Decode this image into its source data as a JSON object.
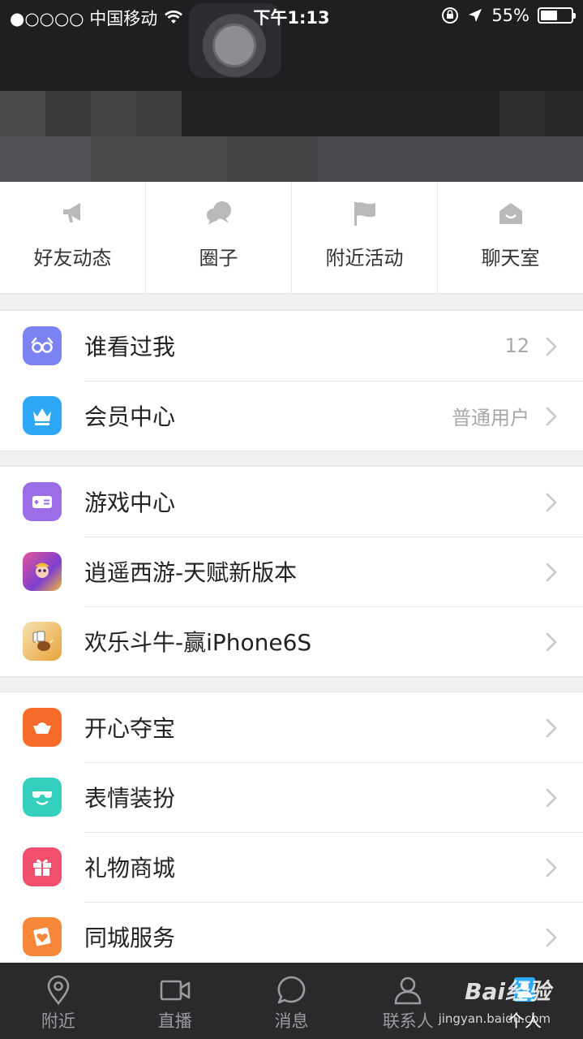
{
  "status_bar": {
    "carrier": "●○○○○ 中国移动",
    "time": "下午1:13",
    "battery": "55%",
    "battery_level": 0.55
  },
  "quick_actions": [
    {
      "label": "好友动态",
      "icon": "megaphone-icon"
    },
    {
      "label": "圈子",
      "icon": "chat-bubbles-icon"
    },
    {
      "label": "附近活动",
      "icon": "flag-icon"
    },
    {
      "label": "聊天室",
      "icon": "house-icon"
    }
  ],
  "group1": [
    {
      "label": "谁看过我",
      "value": "12",
      "icon": "glasses-icon",
      "color": "#7b83f2"
    },
    {
      "label": "会员中心",
      "value": "普通用户",
      "icon": "crown-icon",
      "color": "#2ea7f5"
    }
  ],
  "group2": [
    {
      "label": "游戏中心",
      "value": "",
      "icon": "gamepad-icon",
      "color": "#9b6ee8"
    },
    {
      "label": "逍遥西游-天赋新版本",
      "value": "",
      "icon": "game-xiyou-icon",
      "color": "#8b4fd8"
    },
    {
      "label": "欢乐斗牛-赢iPhone6S",
      "value": "",
      "icon": "game-douniu-icon",
      "color": "#e8a23a"
    }
  ],
  "group3": [
    {
      "label": "开心夺宝",
      "value": "",
      "icon": "ingot-icon",
      "color": "#f76b2a"
    },
    {
      "label": "表情装扮",
      "value": "",
      "icon": "sunglasses-face-icon",
      "color": "#35cfc0"
    },
    {
      "label": "礼物商城",
      "value": "",
      "icon": "gift-icon",
      "color": "#f0506e"
    },
    {
      "label": "同城服务",
      "value": "",
      "icon": "heart-card-icon",
      "color": "#f7883a"
    }
  ],
  "tabs": [
    {
      "label": "附近",
      "icon": "location-pin-icon"
    },
    {
      "label": "直播",
      "icon": "video-camera-icon"
    },
    {
      "label": "消息",
      "icon": "message-bubble-icon"
    },
    {
      "label": "联系人",
      "icon": "person-icon"
    },
    {
      "label": "个人",
      "icon": "profile-icon"
    }
  ],
  "watermark": {
    "text": "Bai经验",
    "sub": "jingyan.baidu.com"
  }
}
